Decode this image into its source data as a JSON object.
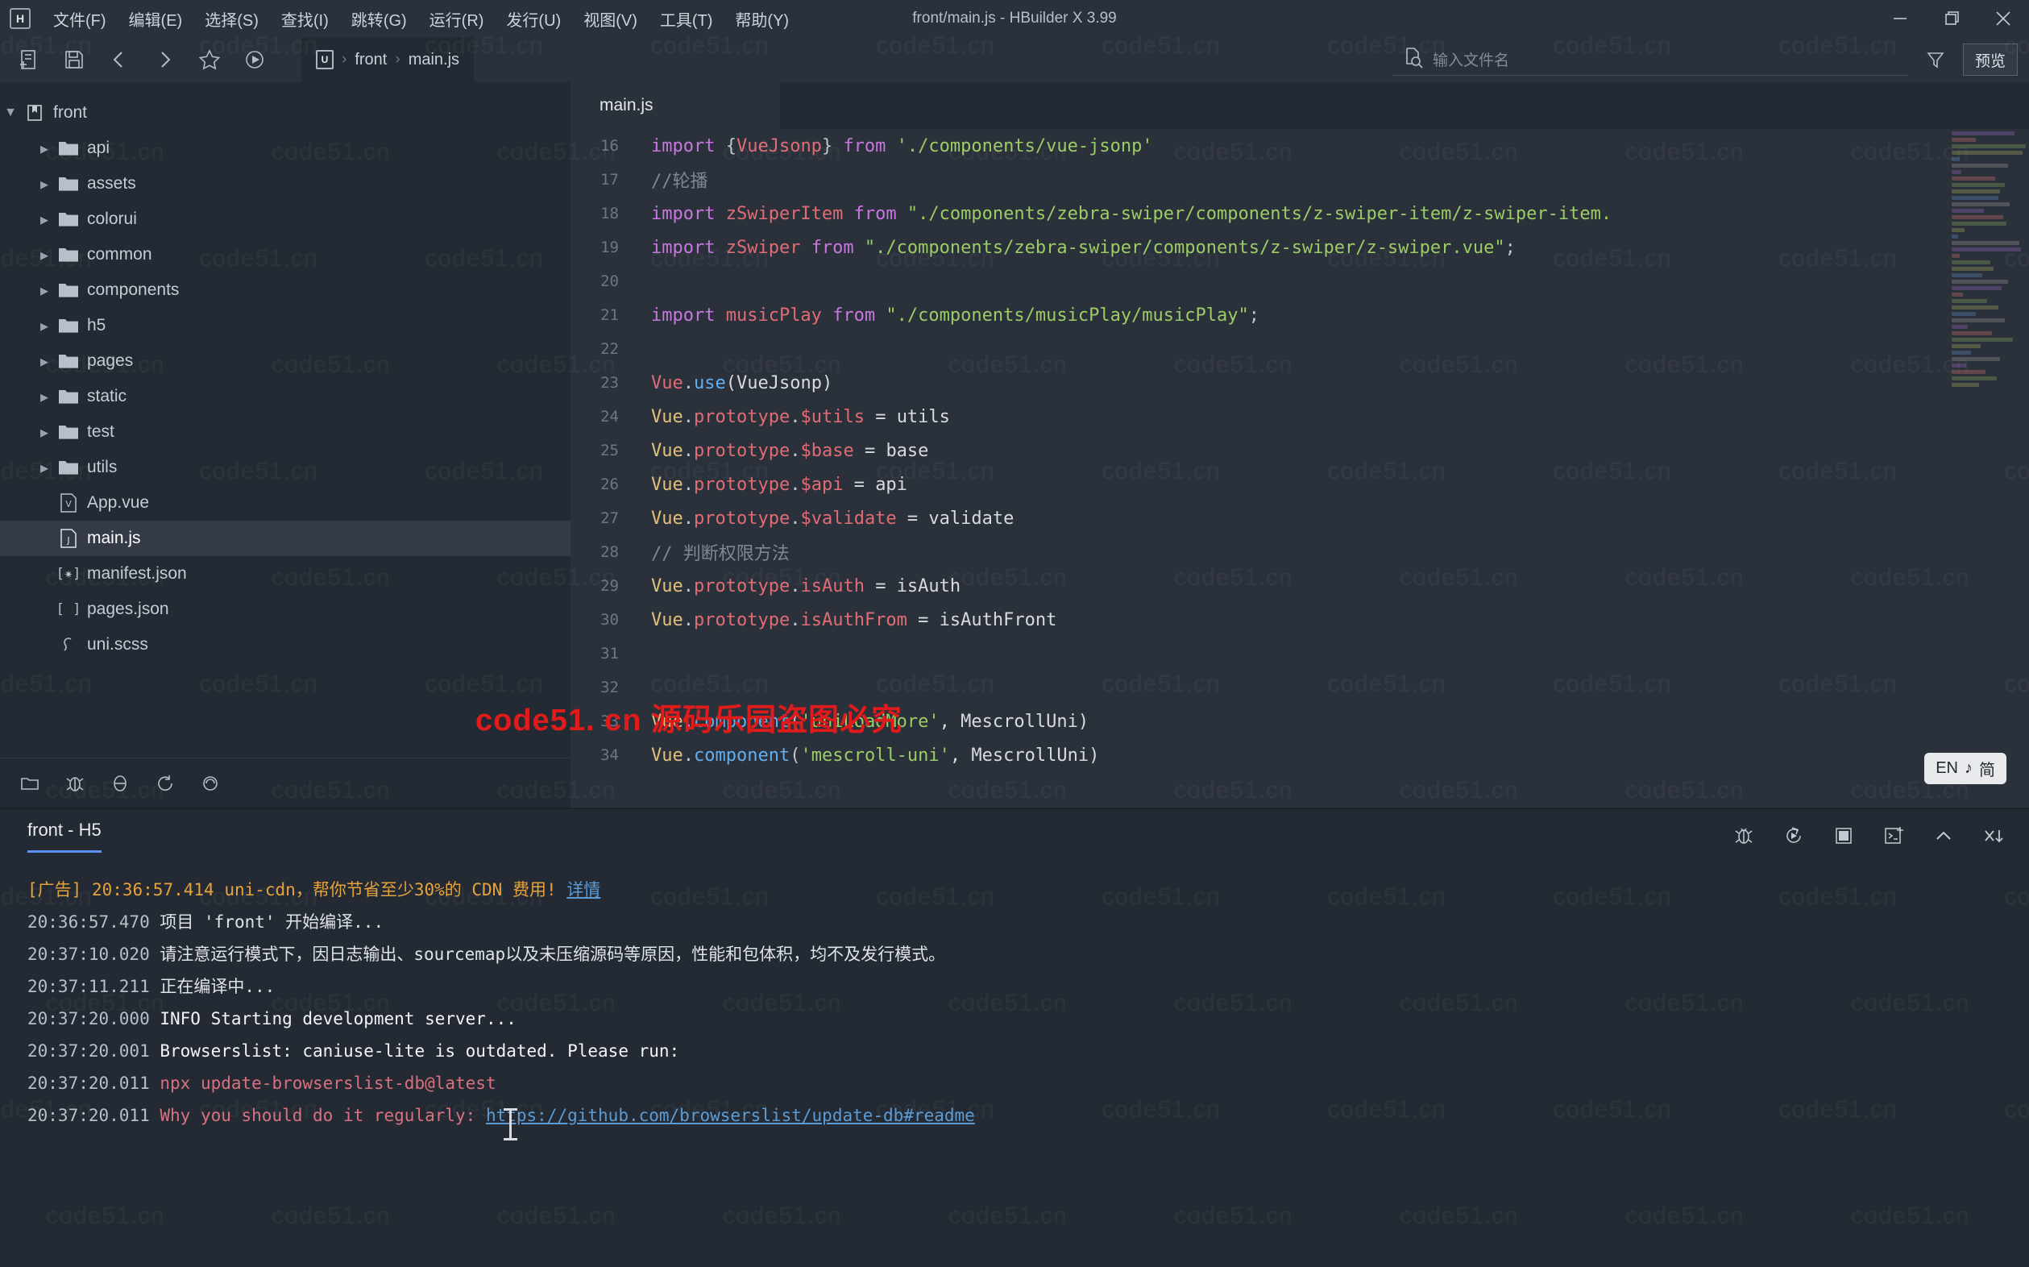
{
  "window": {
    "title": "front/main.js - HBuilder X 3.99",
    "logo_letter": "H",
    "minimize": "─",
    "maximize": "❐",
    "close": "✕"
  },
  "menubar": {
    "items": [
      {
        "label": "文件(F)",
        "name": "menu-file"
      },
      {
        "label": "编辑(E)",
        "name": "menu-edit"
      },
      {
        "label": "选择(S)",
        "name": "menu-select"
      },
      {
        "label": "查找(I)",
        "name": "menu-find"
      },
      {
        "label": "跳转(G)",
        "name": "menu-goto"
      },
      {
        "label": "运行(R)",
        "name": "menu-run"
      },
      {
        "label": "发行(U)",
        "name": "menu-publish"
      },
      {
        "label": "视图(V)",
        "name": "menu-view"
      },
      {
        "label": "工具(T)",
        "name": "menu-tools"
      },
      {
        "label": "帮助(Y)",
        "name": "menu-help"
      }
    ]
  },
  "toolbar": {
    "icons": [
      "new-file-icon",
      "save-icon",
      "back-icon",
      "forward-icon",
      "favorite-icon",
      "run-icon"
    ],
    "breadcrumb": {
      "project_badge": "U",
      "project": "front",
      "file": "main.js",
      "separator": "›"
    },
    "search_placeholder": "输入文件名",
    "filter_icon": "funnel-icon",
    "preview_label": "预览"
  },
  "sidebar": {
    "root": {
      "label": "front",
      "expanded": true,
      "icon": "project-icon"
    },
    "items": [
      {
        "label": "api",
        "type": "folder",
        "indent": 1
      },
      {
        "label": "assets",
        "type": "folder",
        "indent": 1
      },
      {
        "label": "colorui",
        "type": "folder",
        "indent": 1
      },
      {
        "label": "common",
        "type": "folder",
        "indent": 1
      },
      {
        "label": "components",
        "type": "folder",
        "indent": 1
      },
      {
        "label": "h5",
        "type": "folder",
        "indent": 1
      },
      {
        "label": "pages",
        "type": "folder",
        "indent": 1
      },
      {
        "label": "static",
        "type": "folder",
        "indent": 1
      },
      {
        "label": "test",
        "type": "folder",
        "indent": 1
      },
      {
        "label": "utils",
        "type": "folder",
        "indent": 1
      },
      {
        "label": "App.vue",
        "type": "vue",
        "indent": 1,
        "icon_text": "V"
      },
      {
        "label": "main.js",
        "type": "js",
        "indent": 1,
        "icon_text": "J",
        "active": true
      },
      {
        "label": "manifest.json",
        "type": "json",
        "indent": 1,
        "icon_text": "[✻]"
      },
      {
        "label": "pages.json",
        "type": "jsonarr",
        "indent": 1,
        "icon_text": "[ ]"
      },
      {
        "label": "uni.scss",
        "type": "scss",
        "indent": 1,
        "icon_text": "S"
      }
    ],
    "bottom_icons": [
      "explorer-icon",
      "bug-icon",
      "debug-icon",
      "refresh-icon",
      "sync-icon"
    ]
  },
  "editor": {
    "tabs": [
      {
        "label": "main.js",
        "active": true
      }
    ],
    "lines": [
      {
        "n": "16",
        "tokens": [
          {
            "t": "import ",
            "c": "k-import"
          },
          {
            "t": "{",
            "c": "k-punc"
          },
          {
            "t": "VueJsonp",
            "c": "k-ident"
          },
          {
            "t": "}",
            "c": "k-punc"
          },
          {
            "t": " ",
            "c": "k-plain"
          },
          {
            "t": "from",
            "c": "k-import"
          },
          {
            "t": " ",
            "c": "k-plain"
          },
          {
            "t": "'./components/vue-jsonp'",
            "c": "k-str"
          }
        ]
      },
      {
        "n": "17",
        "tokens": [
          {
            "t": "//轮播",
            "c": "k-cmt"
          }
        ]
      },
      {
        "n": "18",
        "tokens": [
          {
            "t": "import ",
            "c": "k-import"
          },
          {
            "t": "zSwiperItem",
            "c": "k-ident"
          },
          {
            "t": " ",
            "c": "k-plain"
          },
          {
            "t": "from",
            "c": "k-import"
          },
          {
            "t": " ",
            "c": "k-plain"
          },
          {
            "t": "\"./components/zebra-swiper/components/z-swiper-item/z-swiper-item.",
            "c": "k-str"
          }
        ]
      },
      {
        "n": "19",
        "tokens": [
          {
            "t": "import ",
            "c": "k-import"
          },
          {
            "t": "zSwiper",
            "c": "k-ident"
          },
          {
            "t": " ",
            "c": "k-plain"
          },
          {
            "t": "from",
            "c": "k-import"
          },
          {
            "t": " ",
            "c": "k-plain"
          },
          {
            "t": "\"./components/zebra-swiper/components/z-swiper/z-swiper.vue\"",
            "c": "k-str"
          },
          {
            "t": ";",
            "c": "k-punc"
          }
        ]
      },
      {
        "n": "20",
        "tokens": []
      },
      {
        "n": "21",
        "tokens": [
          {
            "t": "import ",
            "c": "k-import"
          },
          {
            "t": "musicPlay",
            "c": "k-ident"
          },
          {
            "t": " ",
            "c": "k-plain"
          },
          {
            "t": "from",
            "c": "k-import"
          },
          {
            "t": " ",
            "c": "k-plain"
          },
          {
            "t": "\"./components/musicPlay/musicPlay\"",
            "c": "k-str"
          },
          {
            "t": ";",
            "c": "k-punc"
          }
        ]
      },
      {
        "n": "22",
        "tokens": []
      },
      {
        "n": "23",
        "tokens": [
          {
            "t": "Vue",
            "c": "k-vue-r"
          },
          {
            "t": ".",
            "c": "k-punc"
          },
          {
            "t": "use",
            "c": "k-fn"
          },
          {
            "t": "(VueJsonp)",
            "c": "k-plain"
          }
        ]
      },
      {
        "n": "24",
        "tokens": [
          {
            "t": "Vue",
            "c": "k-vue-y"
          },
          {
            "t": ".",
            "c": "k-punc"
          },
          {
            "t": "prototype",
            "c": "k-prop"
          },
          {
            "t": ".",
            "c": "k-punc"
          },
          {
            "t": "$utils",
            "c": "k-prop"
          },
          {
            "t": " = utils",
            "c": "k-plain"
          }
        ]
      },
      {
        "n": "25",
        "tokens": [
          {
            "t": "Vue",
            "c": "k-vue-y"
          },
          {
            "t": ".",
            "c": "k-punc"
          },
          {
            "t": "prototype",
            "c": "k-prop"
          },
          {
            "t": ".",
            "c": "k-punc"
          },
          {
            "t": "$base",
            "c": "k-prop"
          },
          {
            "t": " = base",
            "c": "k-plain"
          }
        ]
      },
      {
        "n": "26",
        "tokens": [
          {
            "t": "Vue",
            "c": "k-vue-y"
          },
          {
            "t": ".",
            "c": "k-punc"
          },
          {
            "t": "prototype",
            "c": "k-prop"
          },
          {
            "t": ".",
            "c": "k-punc"
          },
          {
            "t": "$api",
            "c": "k-prop"
          },
          {
            "t": " = api",
            "c": "k-plain"
          }
        ]
      },
      {
        "n": "27",
        "tokens": [
          {
            "t": "Vue",
            "c": "k-vue-y"
          },
          {
            "t": ".",
            "c": "k-punc"
          },
          {
            "t": "prototype",
            "c": "k-prop"
          },
          {
            "t": ".",
            "c": "k-punc"
          },
          {
            "t": "$validate",
            "c": "k-prop"
          },
          {
            "t": " = validate",
            "c": "k-plain"
          }
        ]
      },
      {
        "n": "28",
        "tokens": [
          {
            "t": "// 判断权限方法",
            "c": "k-cmt"
          }
        ]
      },
      {
        "n": "29",
        "tokens": [
          {
            "t": "Vue",
            "c": "k-vue-y"
          },
          {
            "t": ".",
            "c": "k-punc"
          },
          {
            "t": "prototype",
            "c": "k-prop"
          },
          {
            "t": ".",
            "c": "k-punc"
          },
          {
            "t": "isAuth",
            "c": "k-prop"
          },
          {
            "t": " = isAuth",
            "c": "k-plain"
          }
        ]
      },
      {
        "n": "30",
        "tokens": [
          {
            "t": "Vue",
            "c": "k-vue-y"
          },
          {
            "t": ".",
            "c": "k-punc"
          },
          {
            "t": "prototype",
            "c": "k-prop"
          },
          {
            "t": ".",
            "c": "k-punc"
          },
          {
            "t": "isAuthFrom",
            "c": "k-prop"
          },
          {
            "t": " = isAuthFront",
            "c": "k-plain"
          }
        ]
      },
      {
        "n": "31",
        "tokens": []
      },
      {
        "n": "32",
        "tokens": []
      },
      {
        "n": "33",
        "tokens": [
          {
            "t": "Vue",
            "c": "k-vue-y"
          },
          {
            "t": ".",
            "c": "k-punc"
          },
          {
            "t": "component",
            "c": "k-fn"
          },
          {
            "t": "(",
            "c": "k-punc"
          },
          {
            "t": "'uniLoadMore'",
            "c": "k-str"
          },
          {
            "t": ", MescrollUni)",
            "c": "k-plain"
          }
        ]
      },
      {
        "n": "34",
        "tokens": [
          {
            "t": "Vue",
            "c": "k-vue-y"
          },
          {
            "t": ".",
            "c": "k-punc"
          },
          {
            "t": "component",
            "c": "k-fn"
          },
          {
            "t": "(",
            "c": "k-punc"
          },
          {
            "t": "'mescroll-uni'",
            "c": "k-str"
          },
          {
            "t": ", MescrollUni)",
            "c": "k-plain"
          }
        ]
      }
    ],
    "red_watermark": "code51. cn  源码乐园盗图必究",
    "ime_badge": {
      "lang": "EN",
      "note": "♪",
      "mode": "简"
    }
  },
  "panel": {
    "tab_label": "front - H5",
    "accent": "#5b8ff9",
    "icons": [
      "bug-icon",
      "rerun-icon",
      "stop-icon",
      "new-terminal-icon",
      "collapse-icon",
      "clear-icon"
    ],
    "lines": [
      {
        "segments": [
          {
            "t": "[广告] ",
            "c": "c-ad"
          },
          {
            "t": "20:36:57.414 ",
            "c": "c-ad"
          },
          {
            "t": "uni-cdn，帮你节省至少30%的 CDN 费用! ",
            "c": "c-ad"
          },
          {
            "t": "详情",
            "c": "c-link"
          }
        ]
      },
      {
        "segments": [
          {
            "t": "20:36:57.470 ",
            "c": "c-time"
          },
          {
            "t": "项目 'front' 开始编译...",
            "c": "c-text"
          }
        ]
      },
      {
        "segments": [
          {
            "t": "20:37:10.020 ",
            "c": "c-time"
          },
          {
            "t": "请注意运行模式下，因日志输出、sourcemap以及未压缩源码等原因，性能和包体积，均不及发行模式。",
            "c": "c-text"
          }
        ]
      },
      {
        "segments": [
          {
            "t": "20:37:11.211 ",
            "c": "c-time"
          },
          {
            "t": "正在编译中...",
            "c": "c-text"
          }
        ]
      },
      {
        "segments": [
          {
            "t": "20:37:20.000 ",
            "c": "c-time"
          },
          {
            "t": " INFO  Starting development server...",
            "c": "c-white"
          }
        ]
      },
      {
        "segments": [
          {
            "t": "20:37:20.001 ",
            "c": "c-time"
          },
          {
            "t": "Browserslist: caniuse-lite is outdated. Please run:",
            "c": "c-white"
          }
        ]
      },
      {
        "segments": [
          {
            "t": "20:37:20.011 ",
            "c": "c-time"
          },
          {
            "t": "   npx update-browserslist-db@latest",
            "c": "c-warn"
          }
        ]
      },
      {
        "segments": [
          {
            "t": "20:37:20.011 ",
            "c": "c-time"
          },
          {
            "t": "   Why you should do it regularly: ",
            "c": "c-warn"
          },
          {
            "t": "https://github.com/browserslist/update-db#readme",
            "c": "c-link"
          }
        ]
      }
    ]
  },
  "watermark": {
    "text": "code51.cn"
  }
}
